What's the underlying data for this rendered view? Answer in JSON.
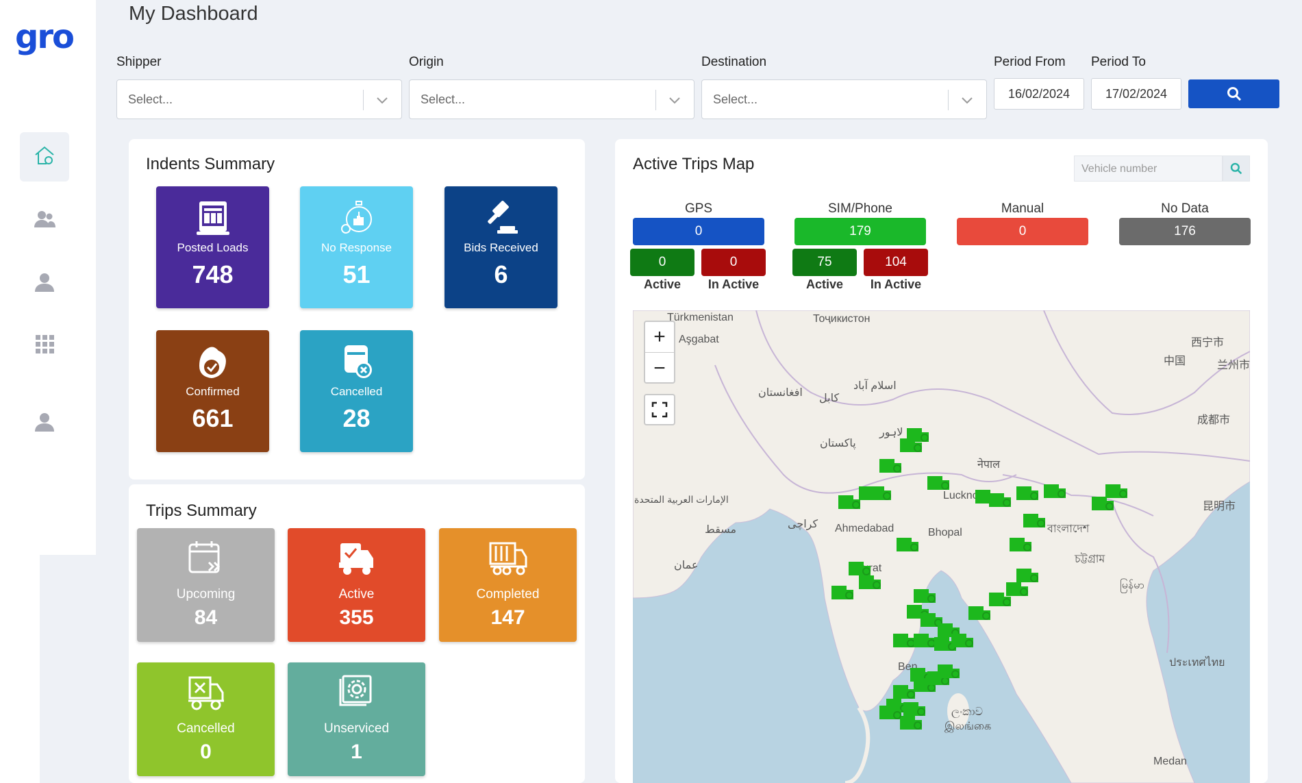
{
  "app": {
    "logo": "gro"
  },
  "header": {
    "title": "My Dashboard"
  },
  "sidebar": {
    "items": [
      {
        "icon": "home-icon",
        "active": true
      },
      {
        "icon": "users-icon",
        "active": false
      },
      {
        "icon": "user-icon",
        "active": false
      },
      {
        "icon": "apps-grid-icon",
        "active": false
      },
      {
        "icon": "profile-icon",
        "active": false
      }
    ]
  },
  "filters": {
    "shipper": {
      "label": "Shipper",
      "placeholder": "Select..."
    },
    "origin": {
      "label": "Origin",
      "placeholder": "Select..."
    },
    "destination": {
      "label": "Destination",
      "placeholder": "Select..."
    },
    "period_from": {
      "label": "Period From",
      "value": "16/02/2024"
    },
    "period_to": {
      "label": "Period To",
      "value": "17/02/2024"
    }
  },
  "indents": {
    "title": "Indents Summary",
    "tiles": [
      {
        "label": "Posted Loads",
        "value": "748",
        "color": "#4a2b9a"
      },
      {
        "label": "No Response",
        "value": "51",
        "color": "#5fd0f2"
      },
      {
        "label": "Bids Received",
        "value": "6",
        "color": "#0c4287"
      },
      {
        "label": "Confirmed",
        "value": "661",
        "color": "#8a4014"
      },
      {
        "label": "Cancelled",
        "value": "28",
        "color": "#2ba3c4"
      }
    ]
  },
  "trips": {
    "title": "Trips Summary",
    "tiles": [
      {
        "label": "Upcoming",
        "value": "84",
        "color": "#b2b2b2"
      },
      {
        "label": "Active",
        "value": "355",
        "color": "#e14b2a"
      },
      {
        "label": "Completed",
        "value": "147",
        "color": "#e5902a"
      },
      {
        "label": "Cancelled",
        "value": "0",
        "color": "#8fc52c"
      },
      {
        "label": "Unserviced",
        "value": "1",
        "color": "#63ad9d"
      }
    ]
  },
  "map_panel": {
    "title": "Active Trips Map",
    "vehicle_placeholder": "Vehicle number",
    "gps": {
      "label": "GPS",
      "value": "0",
      "active": "0",
      "inactive": "0"
    },
    "sim": {
      "label": "SIM/Phone",
      "value": "179",
      "active": "75",
      "inactive": "104"
    },
    "manual": {
      "label": "Manual",
      "value": "0"
    },
    "nodata": {
      "label": "No Data",
      "value": "176"
    },
    "active_label": "Active",
    "inactive_label": "In Active",
    "colors": {
      "gps": "#1553c4",
      "sim": "#1ab82a",
      "manual": "#e84a3c",
      "nodata": "#6b6b6b",
      "active": "#0f7a14",
      "inactive": "#a80c0c",
      "truck": "#1db81d"
    },
    "map_labels": [
      "Türkmenistan",
      "Aşgabat",
      "Тоҷикистон",
      "西宁市",
      "中国",
      "兰州市",
      "افغانستان",
      "کابل",
      "اسلام آباد",
      "لاہور",
      "پاکستان",
      "成都市",
      "नेपाल",
      "Lucknow",
      "الإمارات العربية المتحدة",
      "مسقط",
      "کراچی",
      "Ahmedabad",
      "Bhopal",
      "বাংলাদেশ",
      "昆明市",
      "عمان",
      "Surat",
      "চট্টগ্রাম",
      "မြန်မာ",
      "Ben",
      "ලංකාව",
      "இலங்கை",
      "Medan",
      "ประเทศไทย"
    ]
  }
}
